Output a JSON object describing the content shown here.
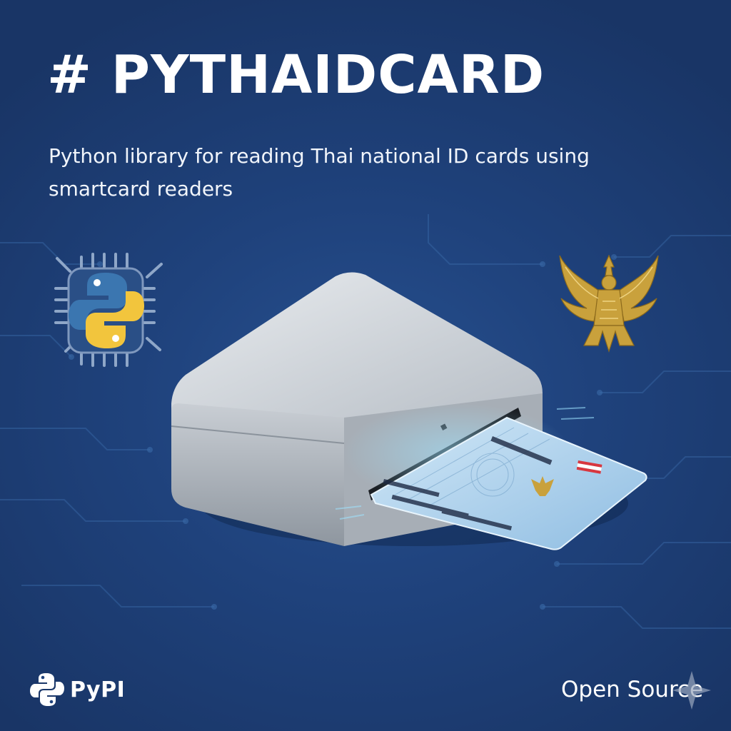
{
  "title": "# PYTHAIDCARD",
  "subtitle": "Python library for reading Thai national ID cards using smartcard readers",
  "footer": {
    "pypi_label": "PyPI",
    "open_source_label": "Open Source"
  },
  "icons": [
    "python-chip-icon",
    "garuda-emblem-icon",
    "card-reader-icon",
    "pypi-logo-icon",
    "sparkle-icon"
  ],
  "colors": {
    "background": "#1f427c",
    "python_blue": "#3b76b0",
    "python_yellow": "#f2c53d",
    "garuda_gold": "#c9a13c",
    "card_blue": "#a9d0ee"
  }
}
